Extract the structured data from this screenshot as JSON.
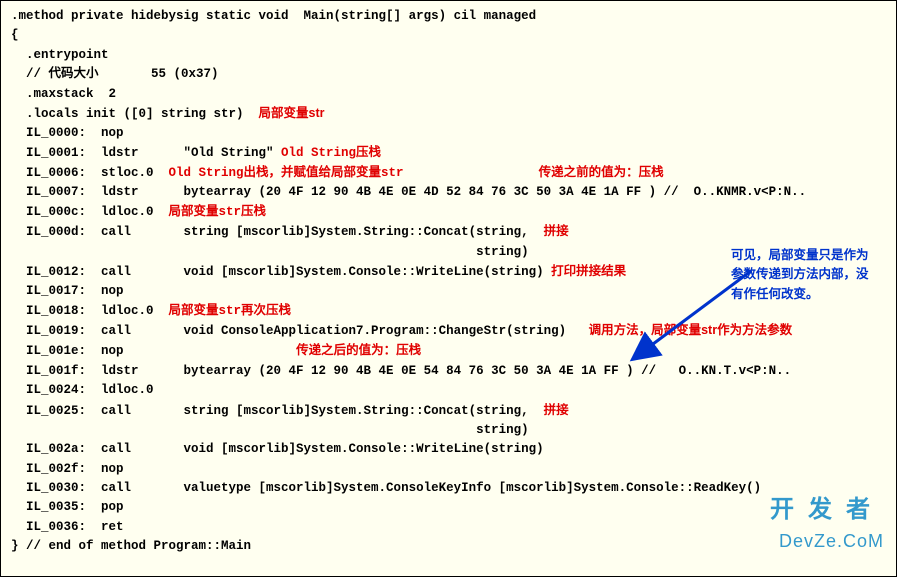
{
  "sig": ".method private hidebysig static void  Main(string[] args) cil managed",
  "brace_open": "{",
  "entry": "  .entrypoint",
  "codesize": "  // 代码大小       55 (0x37)",
  "maxstack": "  .maxstack  2",
  "locals": "  .locals init ([0] string str)  ",
  "locals_ann": "局部变量str",
  "l0000": "  IL_0000:  nop",
  "l0001": "  IL_0001:  ldstr      \"Old String\" ",
  "l0001_ann": "Old String压栈",
  "l0006": "  IL_0006:  stloc.0  ",
  "l0006_ann": "Old String出栈，并赋值给局部变量str",
  "l0007top": "传递之前的值为：压栈",
  "l0007": "  IL_0007:  ldstr      bytearray (20 4F 12 90 4B 4E 0E 4D 52 84 76 3C 50 3A 4E 1A FF ) //  O..KNMR.v<P:N..",
  "l000c": "  IL_000c:  ldloc.0  ",
  "l000c_ann": "局部变量str压栈",
  "l000d_a": "  IL_000d:  call       string [mscorlib]System.String::Concat(string,  ",
  "l000d_ann": "拼接",
  "l000d_b": "                                                              string)",
  "l0012": "  IL_0012:  call       void [mscorlib]System.Console::WriteLine(string) ",
  "l0012_ann": "打印拼接结果",
  "l0017": "  IL_0017:  nop",
  "l0018": "  IL_0018:  ldloc.0  ",
  "l0018_ann": "局部变量str再次压栈",
  "l0019": "  IL_0019:  call       void ConsoleApplication7.Program::ChangeStr(string)   ",
  "l0019_ann": "调用方法，局部变量str作为方法参数",
  "l001e": "  IL_001e:  nop",
  "l001f_top": "传递之后的值为：压栈",
  "l001f": "  IL_001f:  ldstr      bytearray (20 4F 12 90 4B 4E 0E 54 84 76 3C 50 3A 4E 1A FF ) //   O..KN.T.v<P:N..",
  "l0024": "  IL_0024:  ldloc.0",
  "l0025_a": "  IL_0025:  call       string [mscorlib]System.String::Concat(string,  ",
  "l0025_ann": "拼接",
  "l0025_b": "                                                              string)",
  "l002a": "  IL_002a:  call       void [mscorlib]System.Console::WriteLine(string)",
  "l002f": "  IL_002f:  nop",
  "l0030": "  IL_0030:  call       valuetype [mscorlib]System.ConsoleKeyInfo [mscorlib]System.Console::ReadKey()",
  "l0035": "  IL_0035:  pop",
  "l0036": "  IL_0036:  ret",
  "brace_close": "} // end of method Program::Main",
  "note1": "可见，局部变量只是作为",
  "note2": "参数传递到方法内部，没",
  "note3": "有作任何改变。",
  "wm_cn": "开发者",
  "wm_en": "DevZe.CoM"
}
